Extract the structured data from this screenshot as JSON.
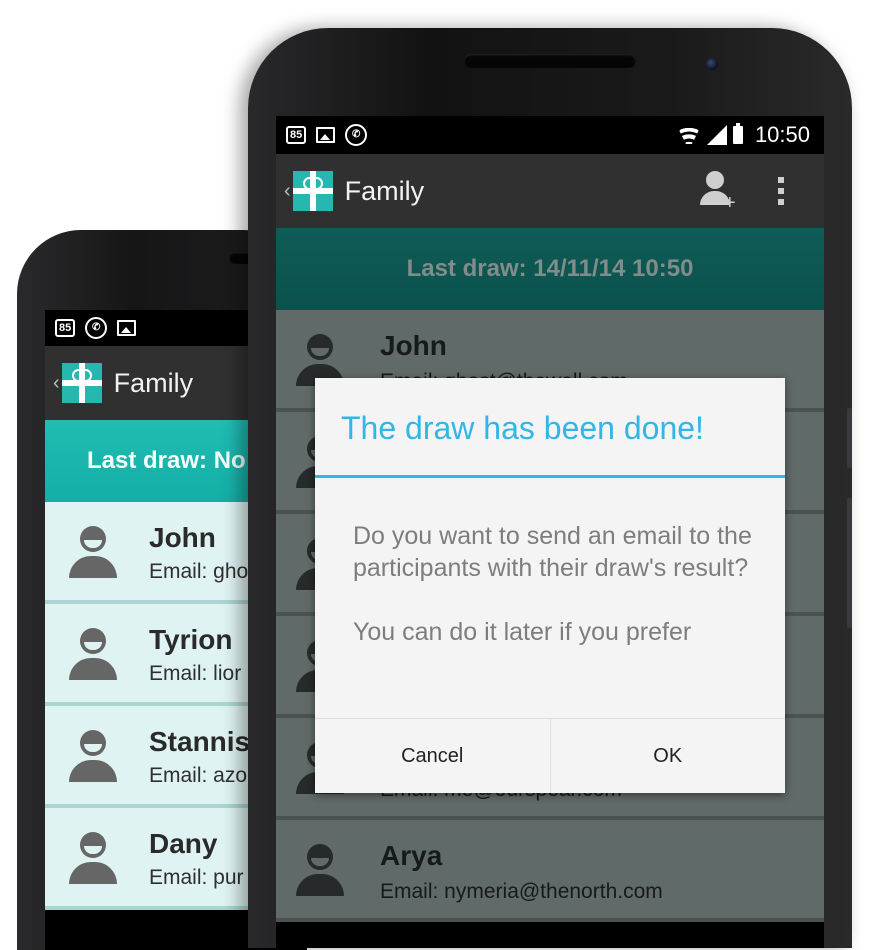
{
  "back_phone": {
    "status_bar": {
      "badge": "85"
    },
    "app_title": "Family",
    "last_draw": "Last draw: No",
    "participants": [
      {
        "name": "John",
        "email": "Email: gho"
      },
      {
        "name": "Tyrion",
        "email": "Email: lior"
      },
      {
        "name": "Stannis",
        "email": "Email: azo"
      },
      {
        "name": "Dany",
        "email": "Email: pur"
      }
    ]
  },
  "front_phone": {
    "status_bar": {
      "badge": "85",
      "time": "10:50"
    },
    "app_title": "Family",
    "last_draw": "Last draw: 14/11/14 10:50",
    "participants": [
      {
        "name": "John",
        "email": "Email: ghost@thewall.com"
      },
      {
        "name": "",
        "email": ""
      },
      {
        "name": "",
        "email": ""
      },
      {
        "name": "",
        "email": ""
      },
      {
        "name": "",
        "email": "Email: me@ourspear.com"
      },
      {
        "name": "Arya",
        "email": "Email: nymeria@thenorth.com"
      }
    ]
  },
  "dialog": {
    "title": "The draw has been done!",
    "message": "Do you want to send an email to the participants with their draw's result?",
    "note": "You can do it later if you prefer",
    "cancel_label": "Cancel",
    "ok_label": "OK"
  },
  "colors": {
    "accent": "#33b5e5",
    "brand_teal": "#26b8b0",
    "action_bar": "#303030"
  }
}
